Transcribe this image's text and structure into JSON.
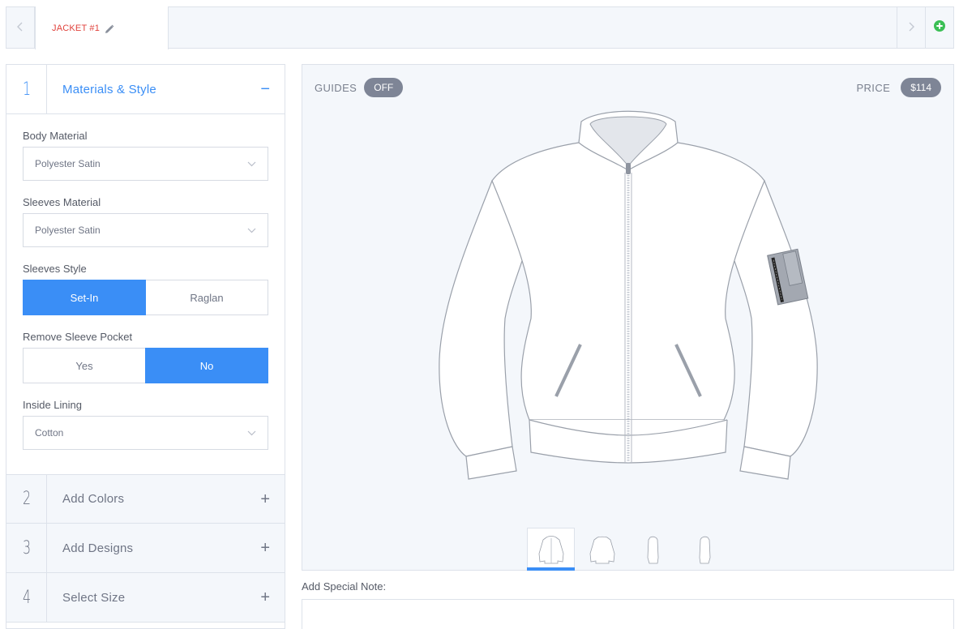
{
  "tabs": {
    "active_label": "JACKET #1"
  },
  "panel": {
    "sections": [
      {
        "number": "1",
        "title": "Materials & Style",
        "toggle": "−"
      },
      {
        "number": "2",
        "title": "Add Colors",
        "toggle": "+"
      },
      {
        "number": "3",
        "title": "Add Designs",
        "toggle": "+"
      },
      {
        "number": "4",
        "title": "Select Size",
        "toggle": "+"
      }
    ],
    "body_material": {
      "label": "Body Material",
      "value": "Polyester Satin"
    },
    "sleeves_material": {
      "label": "Sleeves Material",
      "value": "Polyester Satin"
    },
    "sleeves_style": {
      "label": "Sleeves Style",
      "options": [
        "Set-In",
        "Raglan"
      ],
      "selected": "Set-In"
    },
    "remove_pocket": {
      "label": "Remove Sleeve Pocket",
      "options": [
        "Yes",
        "No"
      ],
      "selected": "No"
    },
    "inside_lining": {
      "label": "Inside Lining",
      "value": "Cotton"
    }
  },
  "preview": {
    "guides_label": "GUIDES",
    "guides_value": "OFF",
    "price_label": "PRICE",
    "price_value": "$114",
    "thumbnails": [
      "front-view",
      "back-view",
      "left-side-view",
      "right-side-view"
    ],
    "selected_thumbnail": 0
  },
  "note": {
    "label": "Add Special Note:",
    "value": ""
  },
  "colors": {
    "accent": "#3a8ef6",
    "tab_label": "#e0423c",
    "add_icon": "#3bbf55",
    "pill": "#7e8596"
  }
}
